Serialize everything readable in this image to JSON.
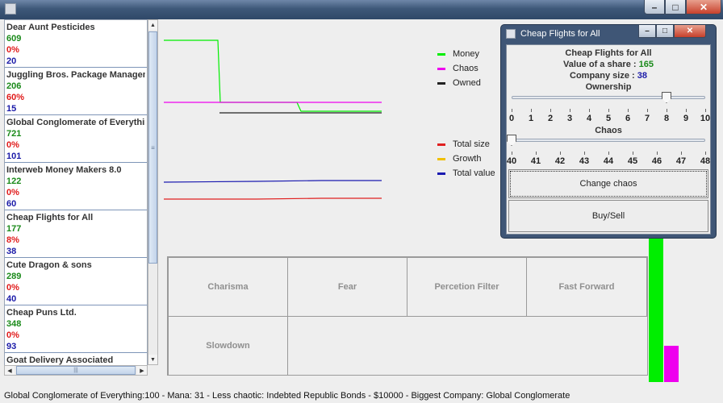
{
  "companies": [
    {
      "name": "Dear Aunt Pesticides",
      "value": "609",
      "chaos": "0%",
      "size": "20"
    },
    {
      "name": "Juggling Bros. Package Management",
      "value": "206",
      "chaos": "60%",
      "size": "15"
    },
    {
      "name": "Global Conglomerate of Everything",
      "value": "721",
      "chaos": "0%",
      "size": "101"
    },
    {
      "name": "Interweb Money Makers 8.0",
      "value": "122",
      "chaos": "0%",
      "size": "60"
    },
    {
      "name": "Cheap Flights for All",
      "value": "177",
      "chaos": "8%",
      "size": "38"
    },
    {
      "name": "Cute Dragon & sons",
      "value": "289",
      "chaos": "0%",
      "size": "40"
    },
    {
      "name": "Cheap Puns Ltd.",
      "value": "348",
      "chaos": "0%",
      "size": "93"
    },
    {
      "name": "Goat Delivery Associated",
      "value": "",
      "chaos": "",
      "size": ""
    }
  ],
  "legend_top": [
    "Money",
    "Chaos",
    "Owned"
  ],
  "legend_bottom": [
    "Total size",
    "Growth",
    "Total value"
  ],
  "colors": {
    "money": "#00ee00",
    "chaos": "#ee00ee",
    "owned": "#222222",
    "total_size": "#e02020",
    "growth": "#f0c000",
    "total_value": "#1a1ab0"
  },
  "powers": [
    "Charisma",
    "Fear",
    "Percetion Filter",
    "Fast Forward",
    "Slowdown"
  ],
  "status": "Global Conglomerate of Everything:100 - Mana: 31 - Less chaotic: Indebted Republic Bonds - $10000 - Biggest Company: Global Conglomerate",
  "dialog": {
    "title": "Cheap Flights for All",
    "company": "Cheap Flights for All",
    "share_label": "Value of a share : ",
    "share_value": "165",
    "size_label": "Company size : ",
    "size_value": "38",
    "ownership_label": "Ownership",
    "ownership_ticks": [
      "0",
      "1",
      "2",
      "3",
      "4",
      "5",
      "6",
      "7",
      "8",
      "9",
      "10"
    ],
    "ownership_value": 8,
    "chaos_label": "Chaos",
    "chaos_ticks": [
      "40",
      "41",
      "42",
      "43",
      "44",
      "45",
      "46",
      "47",
      "48"
    ],
    "chaos_value": 40,
    "change_chaos": "Change chaos",
    "buy_sell": "Buy/Sell"
  },
  "mana_bars": {
    "green": 1.0,
    "magenta": 0.25
  }
}
